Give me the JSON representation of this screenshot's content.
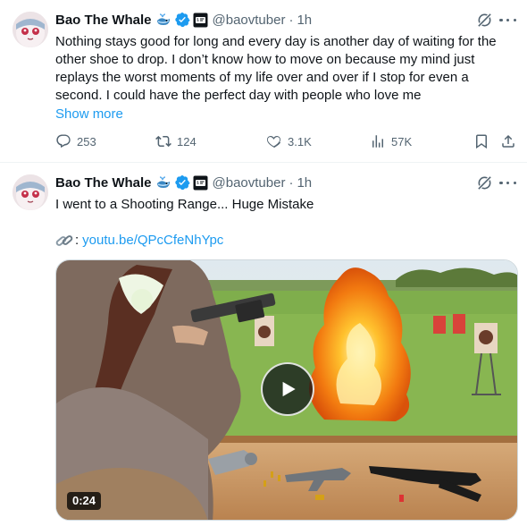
{
  "tweets": [
    {
      "author": {
        "name": "Bao The Whale",
        "handle": "@baovtuber",
        "time": "1h",
        "name_emoji": "whale-emoji"
      },
      "text": "Nothing stays good for long and every day is another day of waiting for the other shoe to drop. I don’t know how to move on because my mind just replays the worst moments of my life over and over if I stop for even a second. I could have the perfect day with people who love me",
      "show_more": "Show more",
      "metrics": {
        "replies": "253",
        "reposts": "124",
        "likes": "3.1K",
        "views": "57K"
      }
    },
    {
      "author": {
        "name": "Bao The Whale",
        "handle": "@baovtuber",
        "time": "1h",
        "name_emoji": "whale-emoji"
      },
      "text": "I went to a Shooting Range... Huge Mistake",
      "link_emoji": "link-emoji",
      "link_colon": ":",
      "link": "youtu.be/QPcCfeNhYpc",
      "video": {
        "duration": "0:24",
        "thumbnail": "woman-firing-rifle-with-explosion-thumbnail"
      }
    }
  ],
  "separator": "·",
  "colors": {
    "text": "#0f1419",
    "secondary": "#536471",
    "accent": "#1d9bf0",
    "divider": "#eff3f4"
  }
}
